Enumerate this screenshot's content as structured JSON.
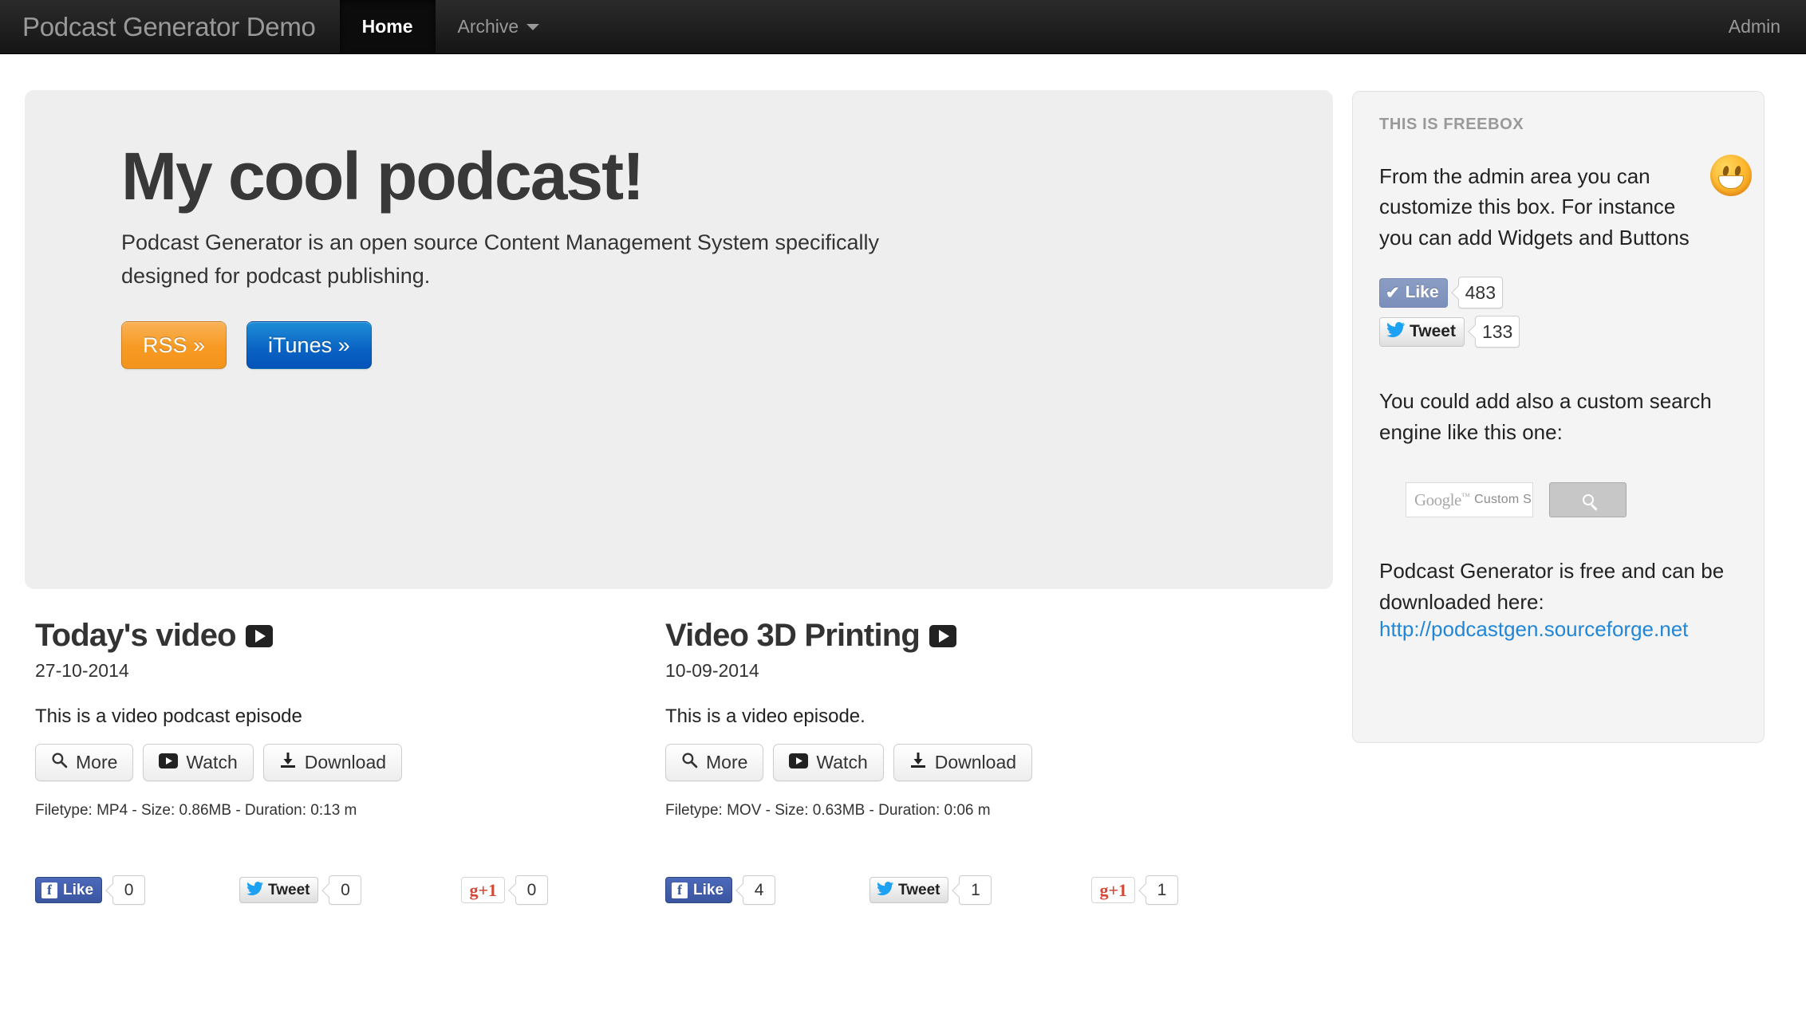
{
  "navbar": {
    "brand": "Podcast Generator Demo",
    "items": [
      {
        "label": "Home",
        "active": true
      },
      {
        "label": "Archive",
        "active": false,
        "caret": true
      }
    ],
    "admin_label": "Admin"
  },
  "hero": {
    "title": "My cool podcast!",
    "description": "Podcast Generator is an open source Content Management System specifically designed for podcast publishing.",
    "rss_button": "RSS »",
    "itunes_button": "iTunes »"
  },
  "episodes": [
    {
      "title": "Today's video",
      "date": "27-10-2014",
      "description": "This is a video podcast episode",
      "buttons": {
        "more": "More",
        "watch": "Watch",
        "download": "Download"
      },
      "meta": "Filetype: MP4 - Size: 0.86MB - Duration: 0:13 m",
      "social": {
        "facebook_label": "Like",
        "facebook_count": "0",
        "twitter_label": "Tweet",
        "twitter_count": "0",
        "gplus_label": "+1",
        "gplus_count": "0"
      }
    },
    {
      "title": "Video 3D Printing",
      "date": "10-09-2014",
      "description": "This is a video episode.",
      "buttons": {
        "more": "More",
        "watch": "Watch",
        "download": "Download"
      },
      "meta": "Filetype: MOV - Size: 0.63MB - Duration: 0:06 m",
      "social": {
        "facebook_label": "Like",
        "facebook_count": "4",
        "twitter_label": "Tweet",
        "twitter_count": "1",
        "gplus_label": "+1",
        "gplus_count": "1"
      }
    }
  ],
  "sidebar": {
    "box_title": "THIS IS FREEBOX",
    "intro_text": "From the admin area you can customize this box. For instance you can add Widgets and Buttons",
    "facebook_label": "Like",
    "facebook_count": "483",
    "twitter_label": "Tweet",
    "twitter_count": "133",
    "search_text": "You could add also a custom search engine like this one:",
    "google_logo": "Google",
    "google_tm": "™",
    "google_sub": "Custom S",
    "download_text": "Podcast Generator is free and can be downloaded here:",
    "download_link": "http://podcastgen.sourceforge.net"
  },
  "colors": {
    "navbar_bg": "#151515",
    "hero_bg": "#eeeeee",
    "rss_orange": "#f3941c",
    "itunes_blue": "#0453b8",
    "link_blue": "#2286d6",
    "facebook_blue": "#3b5998",
    "twitter_blue": "#1da1f2",
    "gplus_red": "#d34836"
  }
}
